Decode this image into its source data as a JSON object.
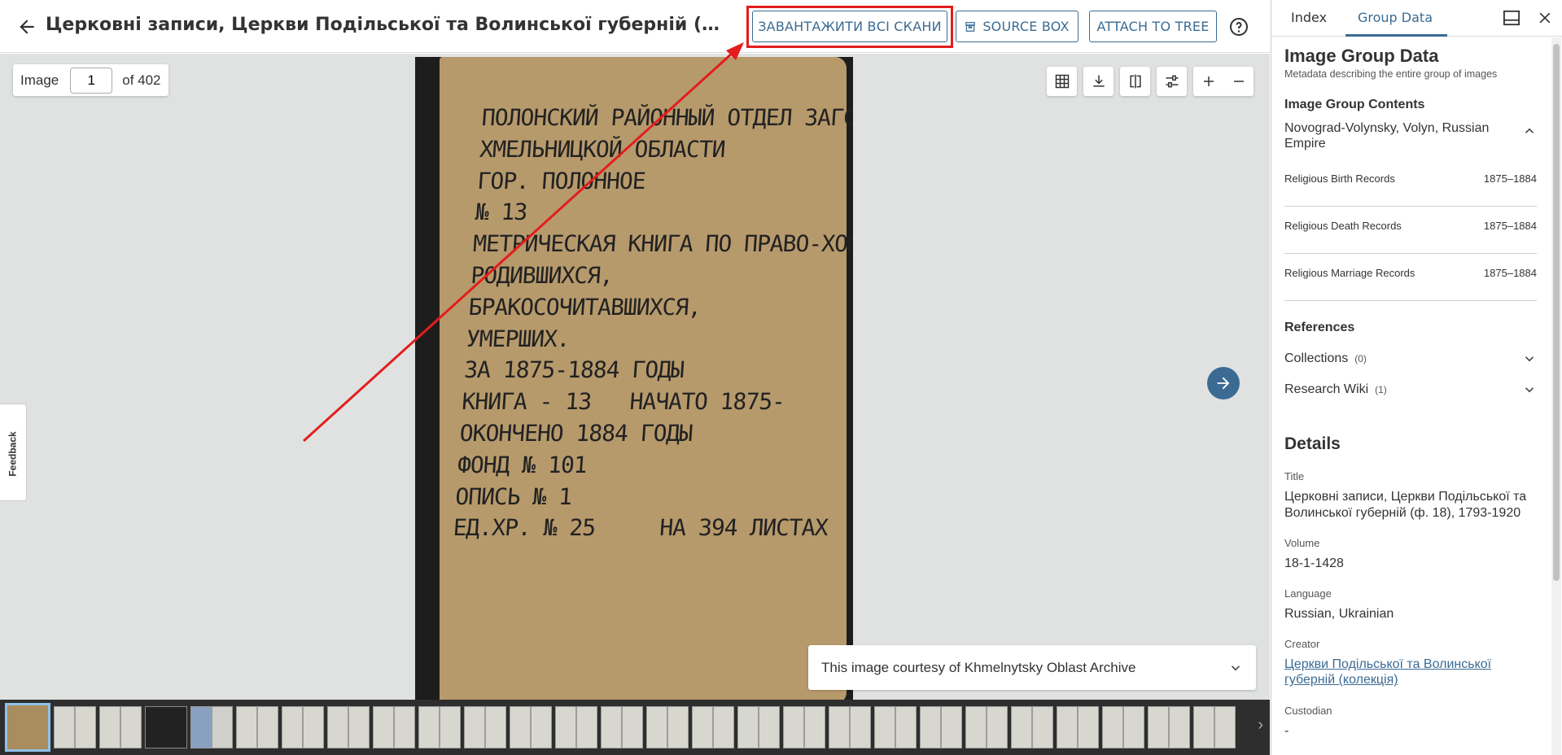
{
  "header": {
    "title": "Церковні записи, Церкви Подільської та Волинської губерній (ф. 18), 1793-...",
    "download_all_label": "ЗАВАНТАЖИТИ ВСІ СКАНИ",
    "source_box_label": "SOURCE BOX",
    "attach_label": "ATTACH TO TREE"
  },
  "viewer": {
    "image_label": "Image",
    "image_value": "1",
    "total_label": "of 402",
    "courtesy_text": "This image courtesy of Khmelnytsky Oblast Archive",
    "feedback_label": "Feedback",
    "scan_text": [
      "Полонский районный отдел ЗАГС",
      "Хмельницкой области",
      "гор. Полонное",
      "№ 13",
      "Метрическая книга по Право-Хоморное",
      "Родившихся,",
      "Бракосочитавшихся,",
      "Умерших.",
      "за 1875-1884 годы",
      "Книга - 13   Начато 1875-",
      "Окончено 1884 годы",
      "Фонд № 101",
      "Опись № 1",
      "Ед.хр. № 25     на 394 листах"
    ]
  },
  "sidebar": {
    "tabs": [
      "Index",
      "Group Data"
    ],
    "group_title": "Image Group Data",
    "group_subtitle": "Metadata describing the entire group of images",
    "contents_title": "Image Group Contents",
    "place": "Novograd-Volynsky, Volyn, Russian Empire",
    "records": [
      {
        "name": "Religious Birth Records",
        "years": "1875–1884"
      },
      {
        "name": "Religious Death Records",
        "years": "1875–1884"
      },
      {
        "name": "Religious Marriage Records",
        "years": "1875–1884"
      }
    ],
    "references_title": "References",
    "references": [
      {
        "label": "Collections",
        "count": "(0)"
      },
      {
        "label": "Research Wiki",
        "count": "(1)"
      }
    ],
    "details_title": "Details",
    "details": {
      "title_label": "Title",
      "title_value": "Церковні записи, Церкви Подільської та Волинської губерній (ф. 18), 1793-1920",
      "volume_label": "Volume",
      "volume_value": "18-1-1428",
      "language_label": "Language",
      "language_value": "Russian, Ukrainian",
      "creator_label": "Creator",
      "creator_value": "Церкви Подільської та Волинської губерній (колекція)",
      "custodian_label": "Custodian",
      "custodian_value": "-"
    }
  },
  "colors": {
    "accent": "#3b6b93",
    "annotation_red": "#e31d1d"
  },
  "icons": [
    "arrow-left-icon",
    "archive-box-icon",
    "help-circle-icon",
    "grid-icon",
    "download-icon",
    "compare-icon",
    "adjust-icon",
    "zoom-in-icon",
    "zoom-out-icon",
    "arrow-right-icon",
    "chevron-down-icon",
    "chevron-up-icon",
    "panel-icon",
    "close-icon"
  ]
}
